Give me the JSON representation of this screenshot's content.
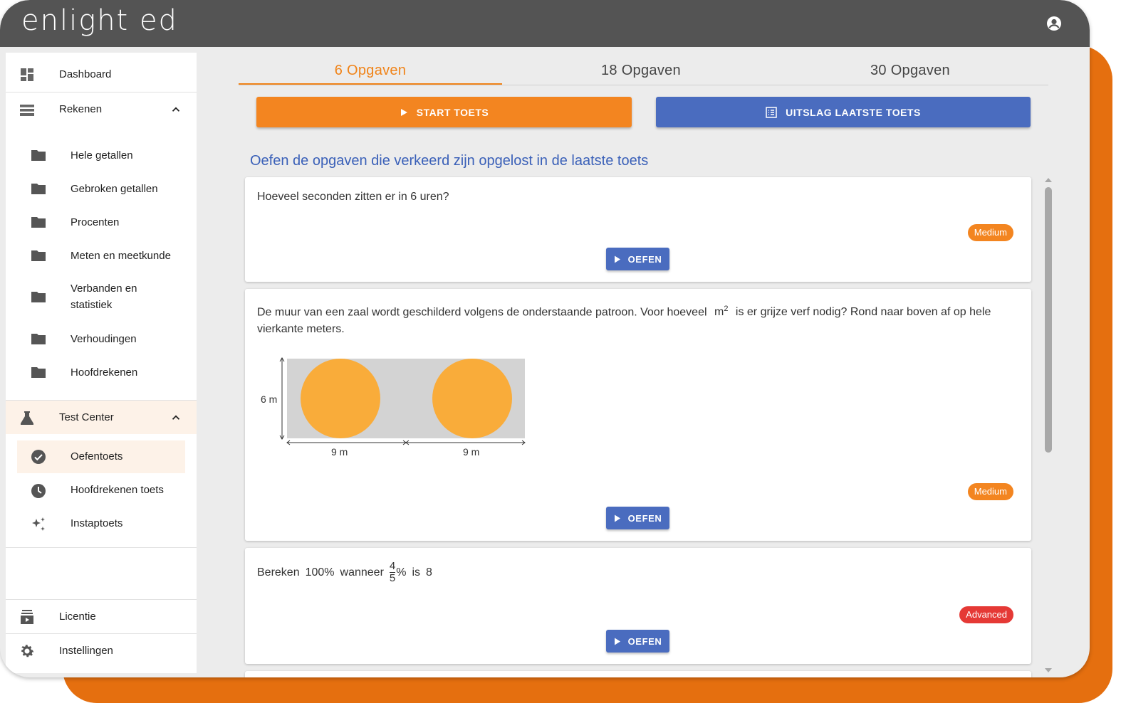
{
  "app": {
    "logo": "enlight ed"
  },
  "sidebar": {
    "dashboard": "Dashboard",
    "rekenen": "Rekenen",
    "rekenen_items": [
      "Hele getallen",
      "Gebroken getallen",
      "Procenten",
      "Meten en meetkunde",
      "Verbanden en statistiek",
      "Verhoudingen",
      "Hoofdrekenen"
    ],
    "test_center": "Test Center",
    "test_items": [
      "Oefentoets",
      "Hoofdrekenen toets",
      "Instaptoets"
    ],
    "licentie": "Licentie",
    "instellingen": "Instellingen"
  },
  "tabs": [
    "6 Opgaven",
    "18 Opgaven",
    "30 Opgaven"
  ],
  "buttons": {
    "start": "START TOETS",
    "result": "UITSLAG LAATSTE TOETS",
    "oefen": "OEFEN"
  },
  "heading": "Oefen de opgaven die verkeerd zijn opgelost in de laatste toets",
  "questions": [
    {
      "text": "Hoeveel seconden zitten er in 6 uren?",
      "level": "Medium"
    },
    {
      "text_a": "De muur van een zaal wordt geschilderd volgens de onderstaande patroon. Voor hoeveel",
      "unit": "m",
      "unit_exp": "2",
      "text_b": "is er grijze verf nodig? Rond naar boven af op hele vierkante meters.",
      "dim_height": "6 m",
      "dim_width_1": "9 m",
      "dim_width_2": "9 m",
      "level": "Medium"
    },
    {
      "text_a": "Bereken",
      "p100": "100%",
      "wanneer": "wanneer",
      "num": "4",
      "den": "5",
      "pct": "%",
      "is": "is",
      "val": "8",
      "level": "Advanced"
    }
  ],
  "colors": {
    "accent": "#f38520",
    "primary": "#4a6cbf",
    "topbar": "#545454",
    "advanced": "#e53935",
    "circle": "#f9ac3a",
    "wall": "#d3d3d3"
  }
}
